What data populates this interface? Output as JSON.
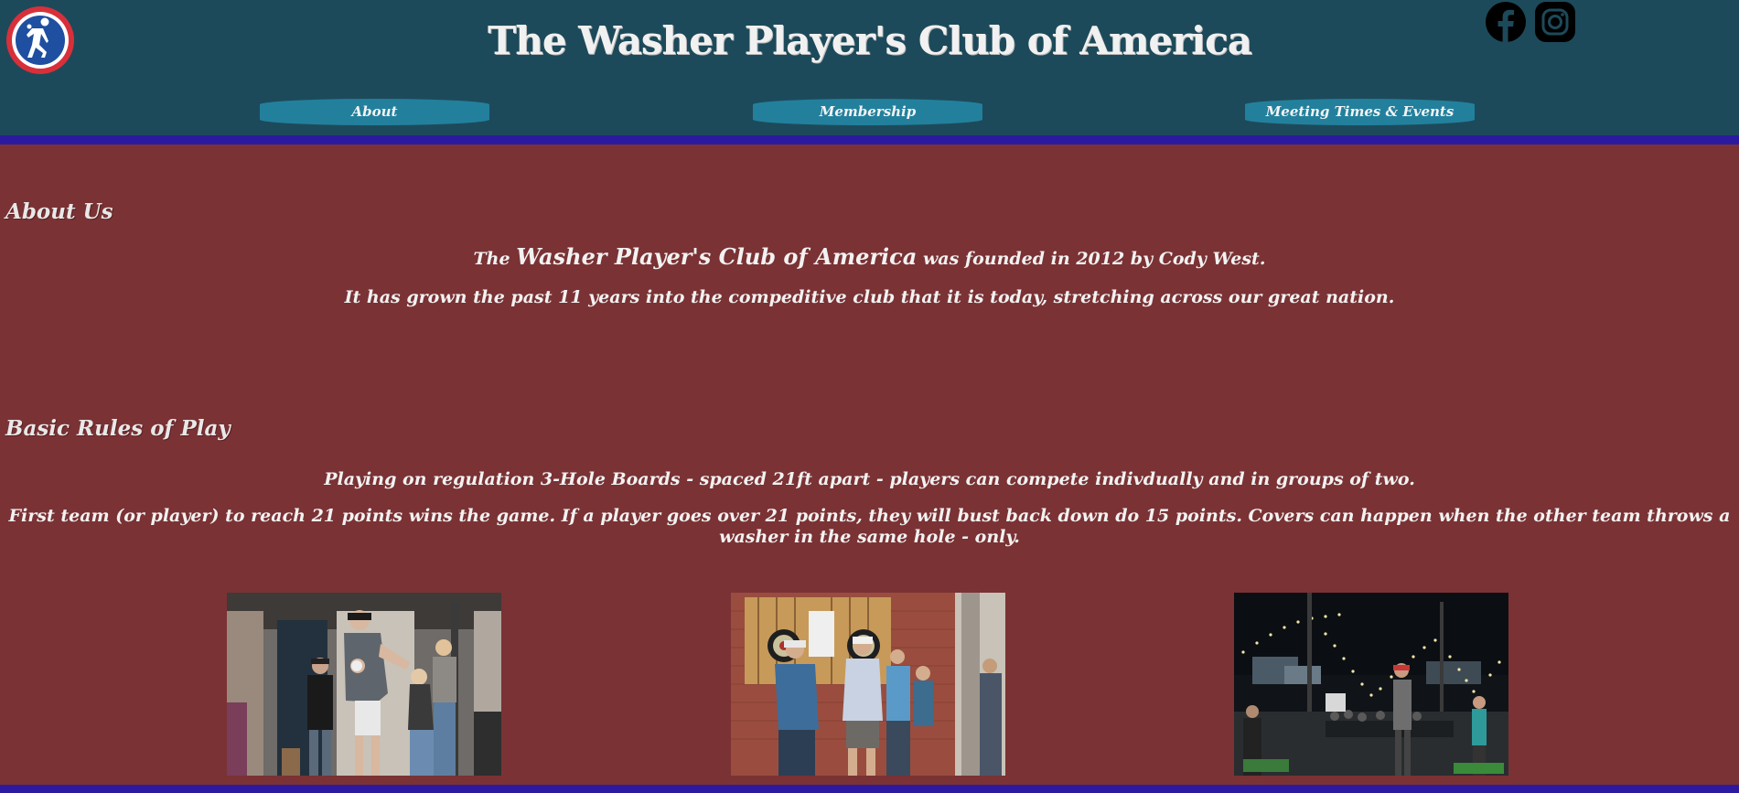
{
  "header": {
    "title": "The Washer Player's Club of America",
    "logo_icon": "washer-thrower-icon",
    "social": [
      {
        "name": "facebook-icon"
      },
      {
        "name": "instagram-icon"
      }
    ]
  },
  "nav": {
    "items": [
      {
        "label": "About"
      },
      {
        "label": "Membership"
      },
      {
        "label": "Meeting Times & Events"
      }
    ]
  },
  "about": {
    "heading": "About Us",
    "p1_pre": "The ",
    "p1_club": "Washer Player's Club of America",
    "p1_post": " was founded in 2012 by Cody West.",
    "p2": "It has grown the past 11 years into the compeditive club that it is today, stretching across our great nation."
  },
  "rules": {
    "heading": "Basic Rules of Play",
    "p1": "Playing on regulation 3-Hole Boards - spaced 21ft apart - players can compete indivdually and in groups of two.",
    "p2": "First team (or player) to reach 21 points wins the game. If a player goes over 21 points, they will bust back down do 15 points. Covers can happen when the other team throws a washer in the same hole - only."
  },
  "colors": {
    "header_bg": "#1d4a5a",
    "page_bg": "#7a3234",
    "stripe": "#2b1aa0",
    "button": "#22809d"
  }
}
